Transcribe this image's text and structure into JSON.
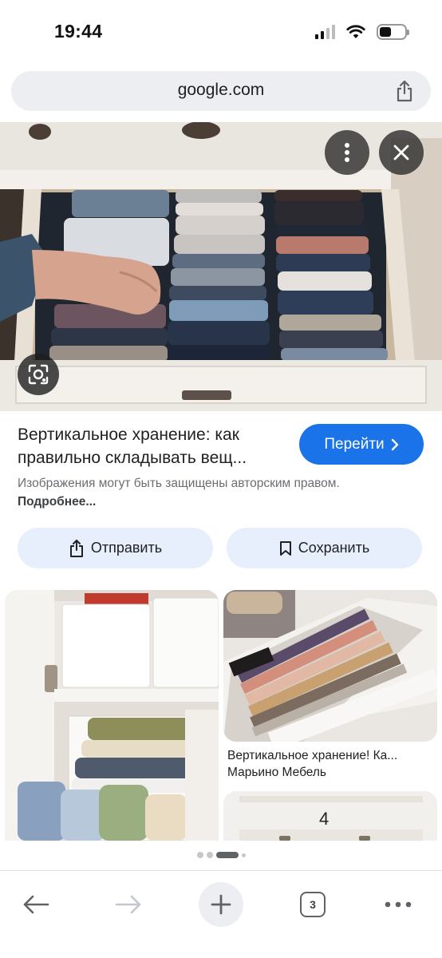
{
  "status_bar": {
    "time": "19:44",
    "icons": [
      "signal-icon",
      "wifi-icon",
      "battery-icon"
    ]
  },
  "address_bar": {
    "url": "google.com",
    "share_icon": "share-icon"
  },
  "hero": {
    "more_icon": "more-vert-icon",
    "close_icon": "close-icon",
    "lens_icon": "lens-icon"
  },
  "result": {
    "title": "Вертикальное хранение: как правильно складывать вещ...",
    "visit_label": "Перейти",
    "copyright_text": "Изображения могут быть защищены авторским правом.",
    "learn_more": "Подробнее..."
  },
  "actions": {
    "send_label": "Отправить",
    "save_label": "Сохранить"
  },
  "related": {
    "right_caption": "Вертикальное хранение! Ка...",
    "right_source": "Марьино Мебель"
  },
  "pager": {
    "active_index": 2
  },
  "toolbar": {
    "tabs_count": "3"
  },
  "colors": {
    "accent": "#1a73e8",
    "chip_bg": "#e8effc",
    "address_bg": "#eceef1"
  }
}
